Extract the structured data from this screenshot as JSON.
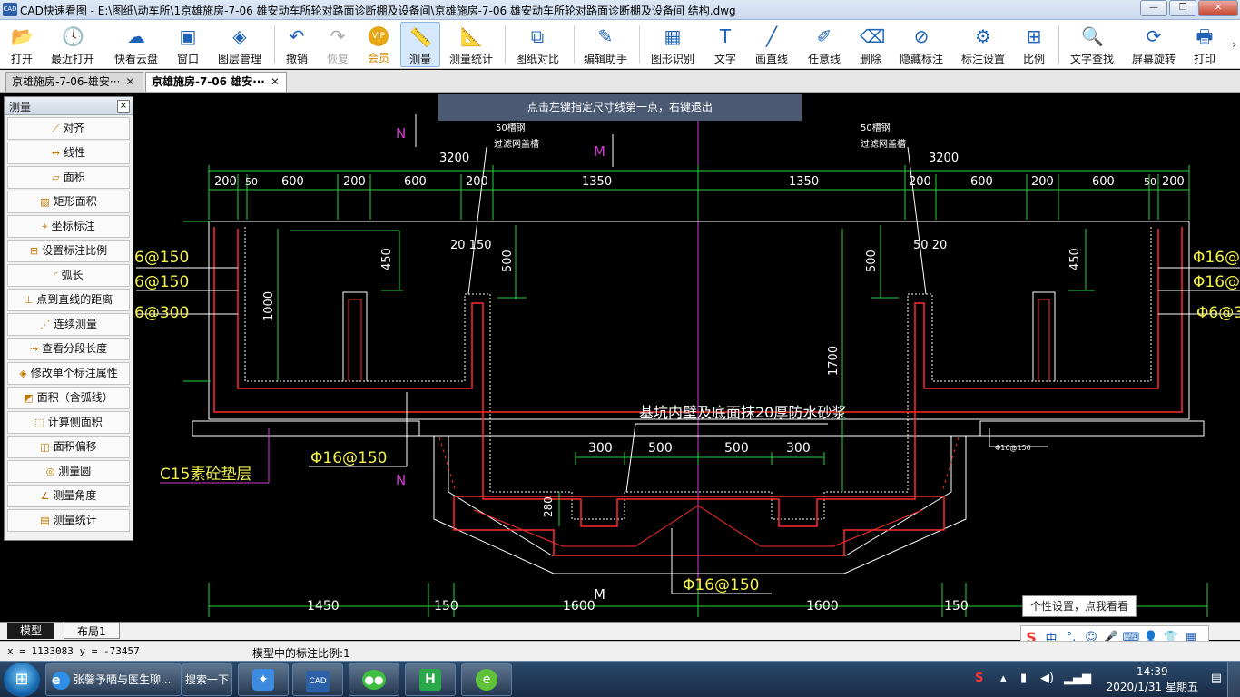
{
  "window": {
    "title": "CAD快速看图 - E:\\图纸\\动车所\\1京雄施房-7-06 雄安动车所轮对路面诊断棚及设备间\\京雄施房-7-06 雄安动车所轮对路面诊断棚及设备间  结构.dwg",
    "app_icon": "CAD",
    "minimize": "—",
    "restore": "❐",
    "close": "✕"
  },
  "toolbar": {
    "items": [
      {
        "label": "打开",
        "icon": "folder-icon",
        "glyph": "📂"
      },
      {
        "label": "最近打开",
        "icon": "clock-icon",
        "glyph": "🕓"
      },
      {
        "label": "快看云盘",
        "icon": "cloud-icon",
        "glyph": "☁"
      },
      {
        "label": "窗口",
        "icon": "window-icon",
        "glyph": "▣"
      },
      {
        "label": "图层管理",
        "icon": "layers-icon",
        "glyph": "◈"
      },
      {
        "label": "撤销",
        "icon": "undo-icon",
        "glyph": "↶"
      },
      {
        "label": "恢复",
        "icon": "redo-icon",
        "glyph": "↷"
      },
      {
        "label": "会员",
        "icon": "vip-icon",
        "glyph": "VIP"
      },
      {
        "label": "测量",
        "icon": "ruler-icon",
        "glyph": "📏"
      },
      {
        "label": "测量统计",
        "icon": "measure-stats-icon",
        "glyph": "📐"
      },
      {
        "label": "图纸对比",
        "icon": "compare-icon",
        "glyph": "⧉"
      },
      {
        "label": "编辑助手",
        "icon": "edit-assistant-icon",
        "glyph": "✎"
      },
      {
        "label": "图形识别",
        "icon": "shape-recognize-icon",
        "glyph": "▦"
      },
      {
        "label": "文字",
        "icon": "text-icon",
        "glyph": "T"
      },
      {
        "label": "画直线",
        "icon": "line-icon",
        "glyph": "╱"
      },
      {
        "label": "任意线",
        "icon": "freehand-icon",
        "glyph": "✐"
      },
      {
        "label": "删除",
        "icon": "eraser-icon",
        "glyph": "⌫"
      },
      {
        "label": "隐藏标注",
        "icon": "hide-icon",
        "glyph": "⊘"
      },
      {
        "label": "标注设置",
        "icon": "settings-icon",
        "glyph": "⚙"
      },
      {
        "label": "比例",
        "icon": "scale-icon",
        "glyph": "⊞"
      },
      {
        "label": "文字查找",
        "icon": "text-search-icon",
        "glyph": "🔍"
      },
      {
        "label": "屏幕旋转",
        "icon": "rotate-icon",
        "glyph": "⟳"
      },
      {
        "label": "打印",
        "icon": "printer-icon",
        "glyph": "🖶"
      }
    ],
    "more": "›"
  },
  "tabs": [
    {
      "label": "京雄施房-7-06-雄安···",
      "close": "✕"
    },
    {
      "label": "京雄施房-7-06  雄安···",
      "close": "✕"
    }
  ],
  "hint": "点击左键指定尺寸线第一点，右键退出",
  "measure_panel": {
    "title": "测量",
    "close": "×",
    "items": [
      "对齐",
      "线性",
      "面积",
      "矩形面积",
      "坐标标注",
      "设置标注比例",
      "弧长",
      "点到直线的距离",
      "连续测量",
      "查看分段长度",
      "修改单个标注属性",
      "面积（含弧线）",
      "计算侧面积",
      "面积偏移",
      "测量圆",
      "测量角度",
      "测量统计"
    ]
  },
  "drawing": {
    "dims_top_left": [
      "200",
      "50",
      "600",
      "200",
      "600",
      "200"
    ],
    "dim_left_total": "3200",
    "dim_center_left": "1350",
    "dim_center_right": "1350",
    "dims_top_right": [
      "200",
      "600",
      "200",
      "600",
      "50",
      "200"
    ],
    "dim_right_total": "3200",
    "note_left": "50槽钢",
    "note_left_2": "过滤网盖槽",
    "note_right": "50槽钢",
    "note_right_2": "过滤网盖槽",
    "label_n": "N",
    "label_m": "M",
    "dim_450": "450",
    "dim_500": "500",
    "dim_1000": "1000",
    "dim_1700": "1700",
    "dim_20_150": "20 150",
    "dim_50_20": "50 20",
    "rebar_left_1": "6@150",
    "rebar_left_2": "6@150",
    "rebar_left_3": "6@300",
    "rebar_right_1": "Φ16@1",
    "rebar_right_2": "Φ16@1",
    "rebar_right_3": "Φ6@3",
    "rebar_bottom_left": "Φ16@150",
    "rebar_bottom_center": "Φ16@150",
    "rebar_small": "Φ16@150",
    "note_center": "基坑内壁及底面抹20厚防水砂浆",
    "dims_pit": [
      "300",
      "500",
      "500",
      "300"
    ],
    "dim_280": "280",
    "concrete_note": "C15素砼垫层",
    "dims_bottom": [
      "1450",
      "150",
      "1600",
      "1600",
      "150"
    ]
  },
  "layout_tabs": [
    "模型",
    "布局1"
  ],
  "status": {
    "coords": "x = 1133083  y = -73457",
    "scale": "模型中的标注比例:1"
  },
  "ime": {
    "tip": "个性设置，点我看看",
    "logo": "S",
    "icons": [
      "中",
      "°,",
      "☺",
      "🎤",
      "⌨",
      "👤",
      "👕",
      "▦"
    ]
  },
  "taskbar": {
    "start": "⊞",
    "ie_label": "张馨予晒与医生聊...",
    "search_label": "搜索一下",
    "apps": [
      "app-icon-1",
      "cad-app-icon",
      "wechat-icon",
      "app-icon-4",
      "browser-icon"
    ],
    "time": "14:39",
    "date": "2020/1/31 星期五",
    "tray_s": "S"
  },
  "colors": {
    "canvas_bg": "#000000",
    "dim_green": "#22d33b",
    "wall_red": "#ff2a2a",
    "text_yellow": "#f2f24a",
    "magenta": "#d33bd3",
    "white": "#ffffff"
  }
}
